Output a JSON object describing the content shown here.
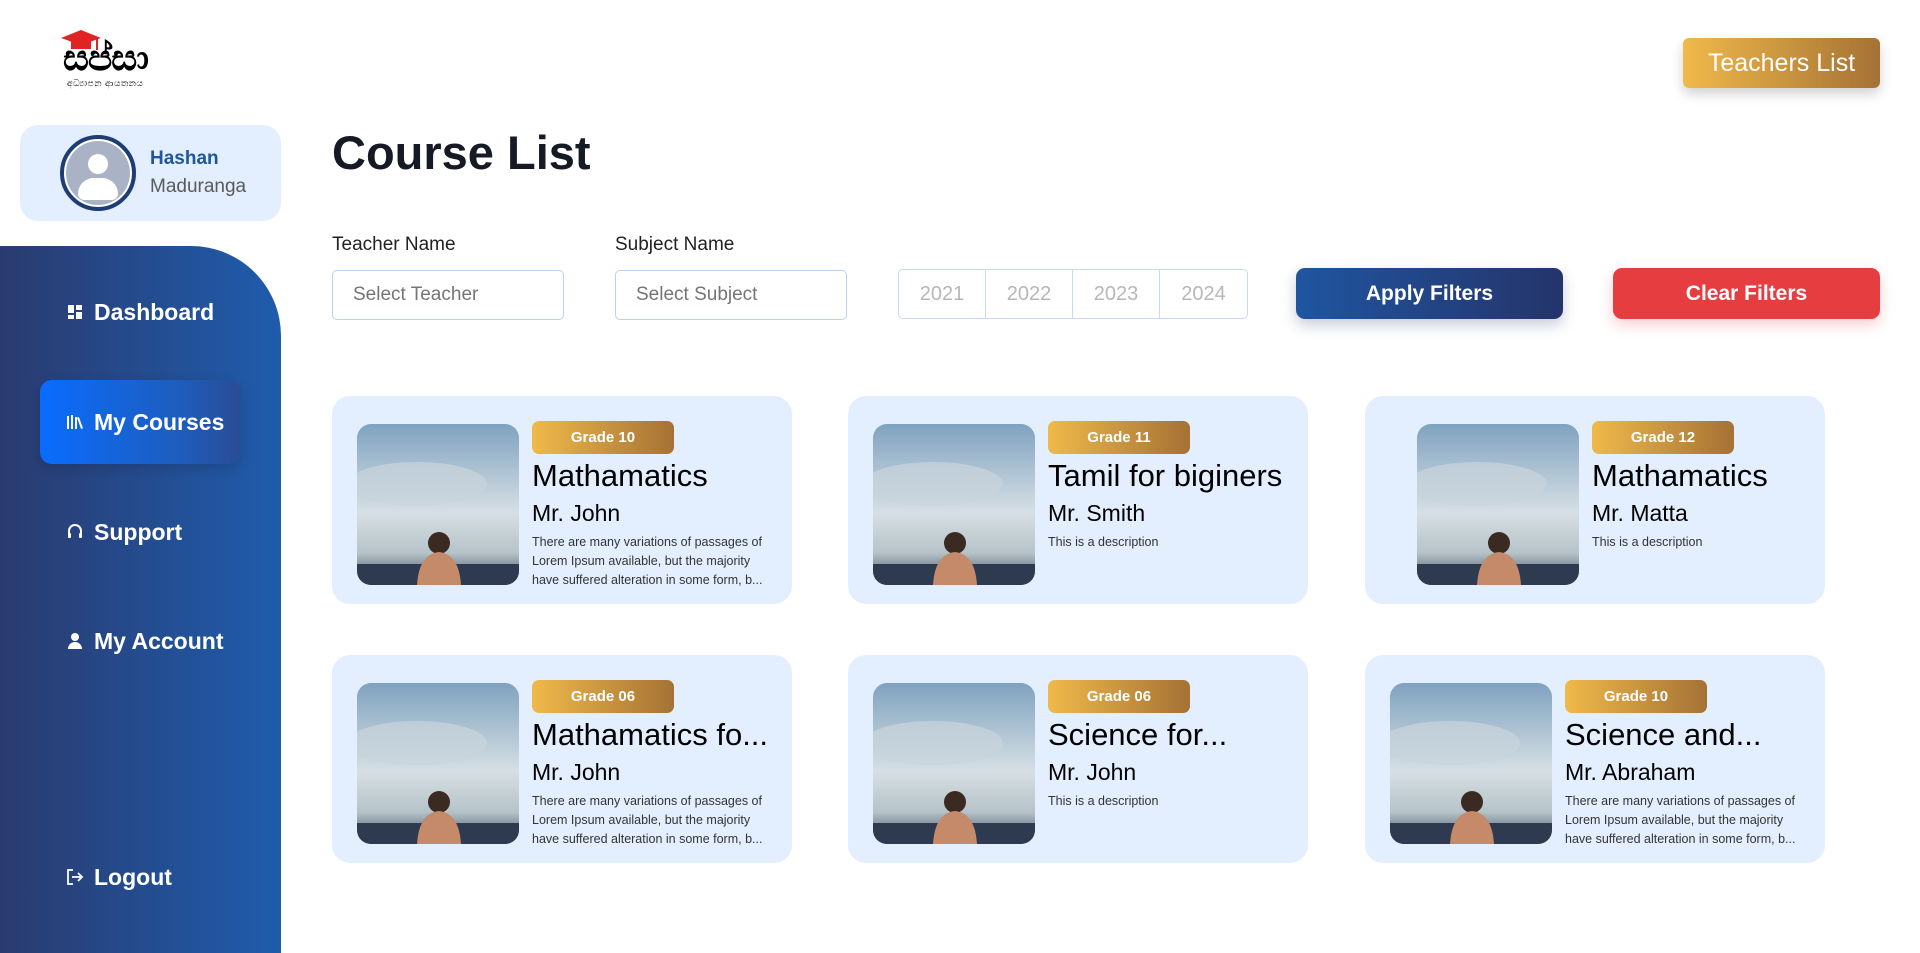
{
  "brand": {
    "logo_text": "සප්සා",
    "tagline": "අධ්‍යාපන ආයතනය"
  },
  "user": {
    "first_name": "Hashan",
    "last_name": "Maduranga"
  },
  "sidebar": {
    "items": [
      {
        "label": "Dashboard",
        "icon": "dashboard-icon"
      },
      {
        "label": "My Courses",
        "icon": "books-icon",
        "active": true
      },
      {
        "label": "Support",
        "icon": "headset-icon"
      },
      {
        "label": "My Account",
        "icon": "user-icon"
      }
    ],
    "logout": {
      "label": "Logout",
      "icon": "logout-icon"
    }
  },
  "header": {
    "teachers_button": "Teachers List"
  },
  "page": {
    "title": "Course List"
  },
  "filters": {
    "teacher_label": "Teacher Name",
    "teacher_placeholder": "Select Teacher",
    "subject_label": "Subject Name",
    "subject_placeholder": "Select Subject",
    "years": [
      "2021",
      "2022",
      "2023",
      "2024"
    ],
    "apply_label": "Apply Filters",
    "clear_label": "Clear Filters"
  },
  "courses": [
    {
      "grade": "Grade 10",
      "title": "Mathamatics",
      "teacher": "Mr. John",
      "description": "There are many variations of passages of Lorem Ipsum available, but the majority have suffered alteration in some form, b..."
    },
    {
      "grade": "Grade 11",
      "title": "Tamil for biginers",
      "teacher": "Mr. Smith",
      "description": "This is a description"
    },
    {
      "grade": "Grade 12",
      "title": "Mathamatics",
      "teacher": "Mr. Matta",
      "description": "This is a description"
    },
    {
      "grade": "Grade 06",
      "title": "Mathamatics fo...",
      "teacher": "Mr. John",
      "description": "There are many variations of passages of Lorem Ipsum available, but the majority have suffered alteration in some form, b..."
    },
    {
      "grade": "Grade 06",
      "title": "Science for...",
      "teacher": "Mr. John",
      "description": "This is a description"
    },
    {
      "grade": "Grade 10",
      "title": "Science and...",
      "teacher": "Mr. Abraham",
      "description": "There are many variations of passages of Lorem Ipsum available, but the majority have suffered alteration in some form, b..."
    }
  ],
  "colors": {
    "accent_blue": "#1f5cad",
    "gold": "#f0b94a",
    "danger": "#e63e40",
    "card_bg": "#e3efff"
  }
}
